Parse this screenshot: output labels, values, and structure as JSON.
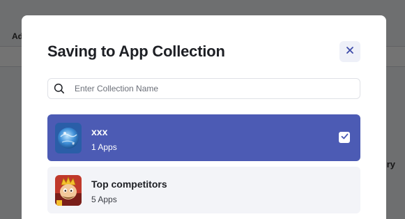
{
  "background": {
    "left_text": "Ad",
    "right_text": "ry"
  },
  "modal": {
    "title": "Saving to App Collection",
    "close_icon": "close-icon",
    "search": {
      "placeholder": "Enter Collection Name",
      "value": "",
      "icon": "search-icon"
    },
    "collections": [
      {
        "name": "xxx",
        "count": "1 Apps",
        "selected": true,
        "thumb_icon": "globe-app-icon"
      },
      {
        "name": "Top competitors",
        "count": "5 Apps",
        "selected": false,
        "thumb_icon": "king-character-app-icon"
      }
    ]
  },
  "colors": {
    "accent": "#4c5bb4",
    "close_icon": "#3d4aa8",
    "item_bg": "#f3f4f8"
  }
}
